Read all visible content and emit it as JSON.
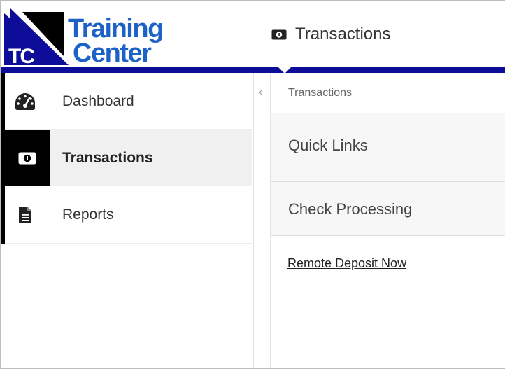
{
  "brand": {
    "logo_mark": "TC",
    "logo_line1": "Training",
    "logo_line2": "Center",
    "primary_color": "#1d62c6",
    "bar_color": "#0d0d99"
  },
  "header": {
    "title": "Transactions",
    "title_icon": "money-icon"
  },
  "sidebar": {
    "items": [
      {
        "label": "Dashboard",
        "icon": "dashboard-gauge-icon",
        "active": false
      },
      {
        "label": "Transactions",
        "icon": "money-icon",
        "active": true
      },
      {
        "label": "Reports",
        "icon": "document-icon",
        "active": false
      }
    ],
    "collapse_glyph": "‹"
  },
  "main": {
    "breadcrumb": "Transactions",
    "sections": [
      {
        "title": "Quick Links"
      },
      {
        "title": "Check Processing"
      }
    ],
    "links": [
      {
        "label": "Remote Deposit Now"
      }
    ]
  }
}
